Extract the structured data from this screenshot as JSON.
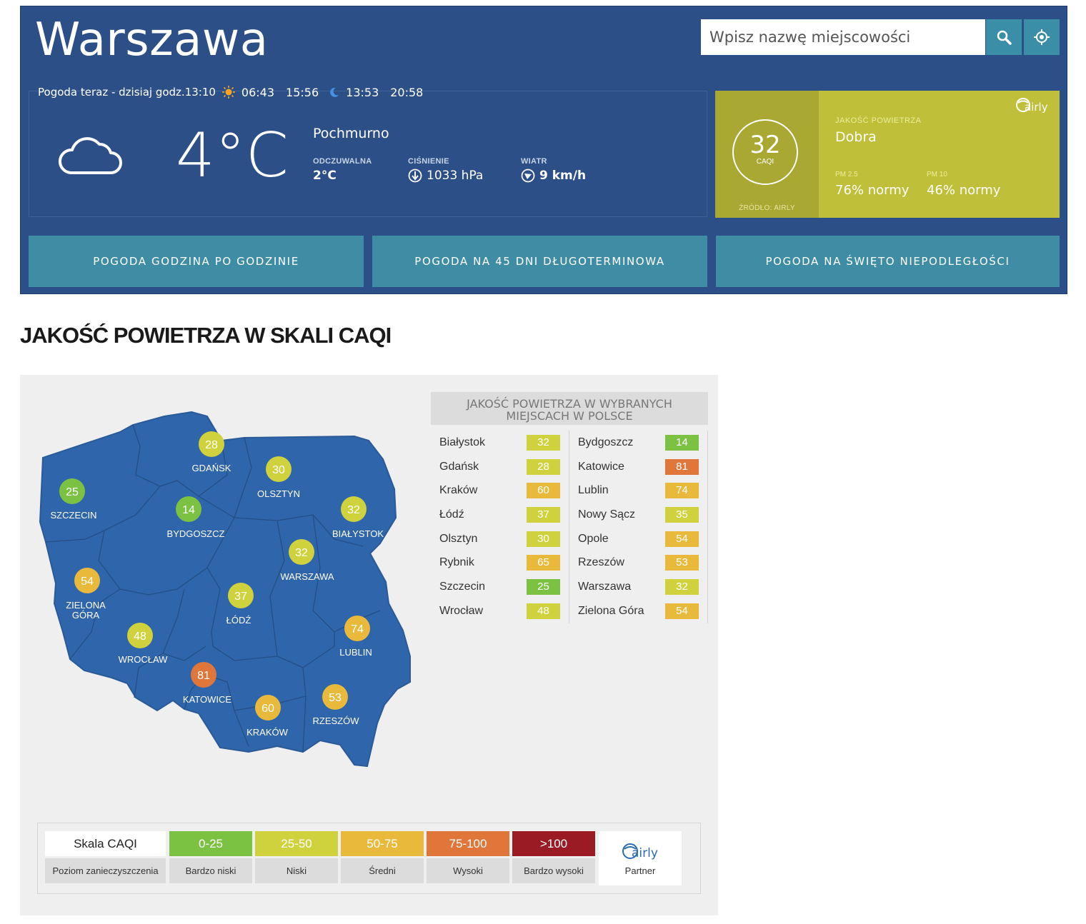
{
  "header": {
    "city": "Warszawa",
    "search_placeholder": "Wpisz nazwę miejscowości",
    "now_label": "Pogoda teraz - dzisiaj godz.13:10",
    "sunrise": "06:43",
    "sunset": "15:56",
    "moonrise": "13:53",
    "moonset": "20:58",
    "temperature": "4°C",
    "condition": "Pochmurno",
    "feels_label": "ODCZUWALNA",
    "feels_value": "2°C",
    "pressure_label": "CIŚNIENIE",
    "pressure_value": "1033 hPa",
    "wind_label": "WIATR",
    "wind_value": "9 km/h"
  },
  "air_quality": {
    "caqi": "32",
    "caqi_unit": "CAQI",
    "source": "ŹRÓDŁO: AIRLY",
    "label": "JAKOŚĆ POWIETRZA",
    "quality": "Dobra",
    "pm25_label": "PM 2.5",
    "pm25_value": "76% normy",
    "pm10_label": "PM 10",
    "pm10_value": "46% normy",
    "brand": "airly"
  },
  "nav": [
    {
      "label": "POGODA GODZINA PO GODZINIE"
    },
    {
      "label": "POGODA NA 45 DNI DŁUGOTERMINOWA"
    },
    {
      "label": "POGODA NA ŚWIĘTO NIEPODLEGŁOŚCI"
    }
  ],
  "section_title": "JAKOŚĆ POWIETRZA W SKALI CAQI",
  "map_cities": [
    {
      "name": "GDAŃSK",
      "value": "28",
      "color": "#cfd23c"
    },
    {
      "name": "OLSZTYN",
      "value": "30",
      "color": "#cfd23c"
    },
    {
      "name": "SZCZECIN",
      "value": "25",
      "color": "#7cc242"
    },
    {
      "name": "BYDGOSZCZ",
      "value": "14",
      "color": "#7cc242"
    },
    {
      "name": "BIAŁYSTOK",
      "value": "32",
      "color": "#cfd23c"
    },
    {
      "name": "WARSZAWA",
      "value": "32",
      "color": "#cfd23c"
    },
    {
      "name": "ZIELONA GÓRA",
      "value": "54",
      "color": "#e8b93a"
    },
    {
      "name": "ŁÓDŹ",
      "value": "37",
      "color": "#cfd23c"
    },
    {
      "name": "WROCŁAW",
      "value": "48",
      "color": "#cfd23c"
    },
    {
      "name": "LUBLIN",
      "value": "74",
      "color": "#e8b93a"
    },
    {
      "name": "KATOWICE",
      "value": "81",
      "color": "#e0763a"
    },
    {
      "name": "KRAKÓW",
      "value": "60",
      "color": "#e8b93a"
    },
    {
      "name": "RZESZÓW",
      "value": "53",
      "color": "#e8b93a"
    }
  ],
  "table": {
    "title": "JAKOŚĆ POWIETRZA W WYBRANYCH MIEJSCACH W POLSCE",
    "left": [
      {
        "name": "Białystok",
        "value": "32",
        "color": "#cfd23c"
      },
      {
        "name": "Gdańsk",
        "value": "28",
        "color": "#cfd23c"
      },
      {
        "name": "Kraków",
        "value": "60",
        "color": "#e8b93a"
      },
      {
        "name": "Łódź",
        "value": "37",
        "color": "#cfd23c"
      },
      {
        "name": "Olsztyn",
        "value": "30",
        "color": "#cfd23c"
      },
      {
        "name": "Rybnik",
        "value": "65",
        "color": "#e8b93a"
      },
      {
        "name": "Szczecin",
        "value": "25",
        "color": "#7cc242"
      },
      {
        "name": "Wrocław",
        "value": "48",
        "color": "#cfd23c"
      }
    ],
    "right": [
      {
        "name": "Bydgoszcz",
        "value": "14",
        "color": "#7cc242"
      },
      {
        "name": "Katowice",
        "value": "81",
        "color": "#e0763a"
      },
      {
        "name": "Lublin",
        "value": "74",
        "color": "#e8b93a"
      },
      {
        "name": "Nowy Sącz",
        "value": "35",
        "color": "#cfd23c"
      },
      {
        "name": "Opole",
        "value": "54",
        "color": "#e8b93a"
      },
      {
        "name": "Rzeszów",
        "value": "53",
        "color": "#e8b93a"
      },
      {
        "name": "Warszawa",
        "value": "32",
        "color": "#cfd23c"
      },
      {
        "name": "Zielona Góra",
        "value": "54",
        "color": "#e8b93a"
      }
    ]
  },
  "legend": {
    "scale_label": "Skala CAQI",
    "level_label": "Poziom zanieczyszczenia",
    "items": [
      {
        "range": "0-25",
        "level": "Bardzo niski",
        "color": "#7cc242"
      },
      {
        "range": "25-50",
        "level": "Niski",
        "color": "#cfd23c"
      },
      {
        "range": "50-75",
        "level": "Średni",
        "color": "#e8b93a"
      },
      {
        "range": "75-100",
        "level": "Wysoki",
        "color": "#e0763a"
      },
      {
        "range": ">100",
        "level": "Bardzo wysoki",
        "color": "#9b1b24"
      }
    ],
    "partner_label": "Partner",
    "partner_brand": "airly"
  }
}
